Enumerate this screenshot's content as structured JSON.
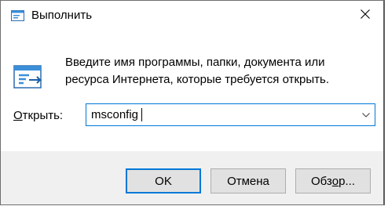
{
  "window": {
    "title": "Выполнить",
    "icon": "run-app-icon",
    "close_icon": "close-icon"
  },
  "content": {
    "description": "Введите имя программы, папки, документа или ресурса Интернета, которые требуется открыть.",
    "open_label_prefix": "",
    "open_label_accel": "О",
    "open_label_rest": "ткрыть:",
    "input_value": "msconfig",
    "dropdown_icon": "chevron-down-icon"
  },
  "buttons": {
    "ok": "OK",
    "cancel": "Отмена",
    "browse_before": "Обз",
    "browse_accel": "о",
    "browse_after": "р..."
  },
  "colors": {
    "accent": "#0078d7",
    "footer_bg": "#f0f0f0",
    "button_bg": "#e1e1e1"
  }
}
